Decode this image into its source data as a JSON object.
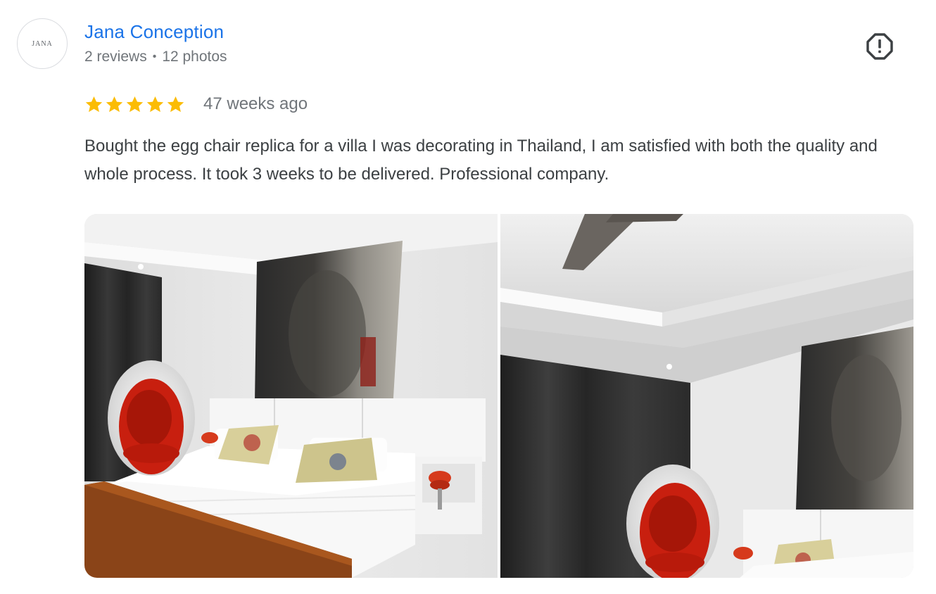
{
  "review": {
    "author": {
      "avatar_text": "JANA",
      "name": "Jana Conception",
      "reviews_count": "2 reviews",
      "separator": "•",
      "photos_count": "12 photos"
    },
    "report_icon": "report-flag-icon",
    "rating": {
      "stars_filled": 5,
      "stars_total": 5,
      "star_color": "#fbbc04"
    },
    "time_ago": "47 weeks ago",
    "text": "Bought the egg chair replica for a villa I was decorating in Thailand, I am satisfied with both the quality and whole process. It took 3 weeks to be delivered. Professional company.",
    "photos_shown": 2
  },
  "colors": {
    "name_link": "#1a73e8",
    "meta_text": "#70757a",
    "body_text": "#3c4043",
    "star": "#fbbc04"
  }
}
